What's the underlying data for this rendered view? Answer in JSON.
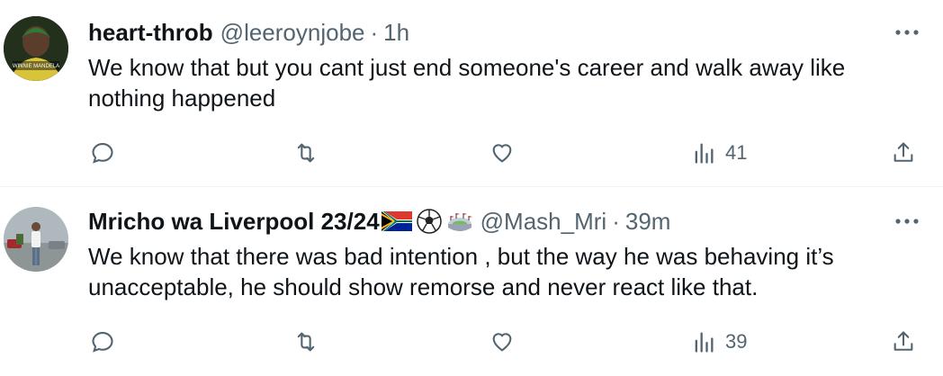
{
  "tweets": [
    {
      "display_name": "heart-throb",
      "handle": "@leeroynjobe",
      "separator": "·",
      "time": "1h",
      "text": "We know that but you cant just end someone's career and walk away like nothing happened",
      "avatar_text": "WINNIE MANDELA",
      "views": "41"
    },
    {
      "display_name": "Mricho wa Liverpool 23/24",
      "handle": "@Mash_Mri",
      "separator": "·",
      "time": "39m",
      "text": "We know that there was bad intention , but the way he was behaving it’s unacceptable, he should show remorse and never react like that.",
      "views": "39"
    }
  ],
  "icons": {
    "more": "more-horizontal-icon",
    "reply": "reply-icon",
    "retweet": "retweet-icon",
    "like": "heart-icon",
    "views": "views-chart-icon",
    "share": "share-icon",
    "flag": "south-africa-flag-icon",
    "ball": "soccer-ball-icon",
    "stadium": "stadium-icon"
  },
  "colors": {
    "text": "#0f1419",
    "muted": "#536471",
    "divider": "#eff3f4"
  }
}
